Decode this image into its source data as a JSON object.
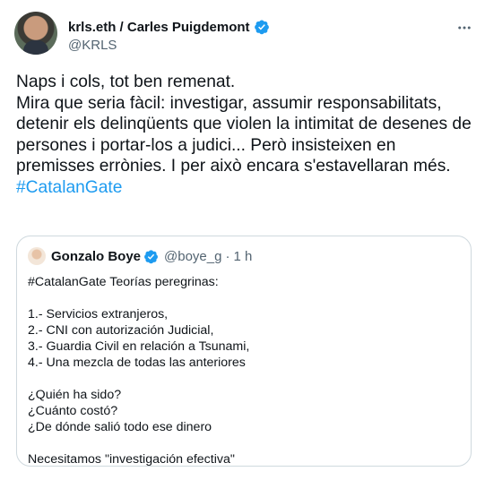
{
  "author": {
    "display_name": "krls.eth / Carles Puigdemont",
    "handle": "@KRLS"
  },
  "tweet": {
    "text": "Naps i cols, tot ben remenat.\nMira que seria fàcil: investigar, assumir responsabilitats, detenir els delinqüents que violen la intimitat de desenes de persones i portar-los a judici... Però insisteixen en premisses errònies. I per això encara s'estavellaran més.",
    "hashtag": "#CatalanGate"
  },
  "quoted": {
    "display_name": "Gonzalo Boye",
    "handle": "@boye_g",
    "separator": "·",
    "time": "1 h",
    "lines": [
      "#CatalanGate Teorías peregrinas:",
      "",
      "1.- Servicios extranjeros,",
      "2.- CNI con autorización Judicial,",
      "3.- Guardia Civil en relación a Tsunami,",
      "4.- Una mezcla de todas las anteriores",
      "",
      "¿Quién ha sido?",
      "¿Cuánto costó?",
      "¿De dónde salió todo ese dinero",
      "",
      "Necesitamos \"investigación efectiva\""
    ]
  },
  "icons": {
    "verified": "verified-badge-icon",
    "more": "more-options-icon"
  },
  "colors": {
    "accent": "#1d9bf0",
    "text": "#0f1419",
    "secondary_text": "#536471",
    "border": "#cfd9de"
  }
}
